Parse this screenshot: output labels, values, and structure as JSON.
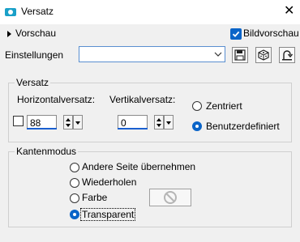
{
  "window": {
    "title": "Versatz",
    "close_glyph": "✕"
  },
  "preview": {
    "label": "Vorschau",
    "preview_checkbox_label": "Bildvorschau",
    "preview_checked": true
  },
  "settings": {
    "label": "Einstellungen",
    "value": ""
  },
  "offset_group": {
    "legend": "Versatz",
    "horizontal_label": "Horizontalversatz:",
    "vertical_label": "Vertikalversatz:",
    "horizontal_value": "88",
    "vertical_value": "0",
    "centered_label": "Zentriert",
    "custom_label": "Benutzerdefiniert",
    "selected": "custom"
  },
  "edge_group": {
    "legend": "Kantenmodus",
    "options": [
      "Andere Seite übernehmen",
      "Wiederholen",
      "Farbe",
      "Transparent"
    ],
    "selected": "Transparent"
  },
  "colors": {
    "accent": "#0a64c8",
    "app_icon": "#1aa0c8"
  }
}
